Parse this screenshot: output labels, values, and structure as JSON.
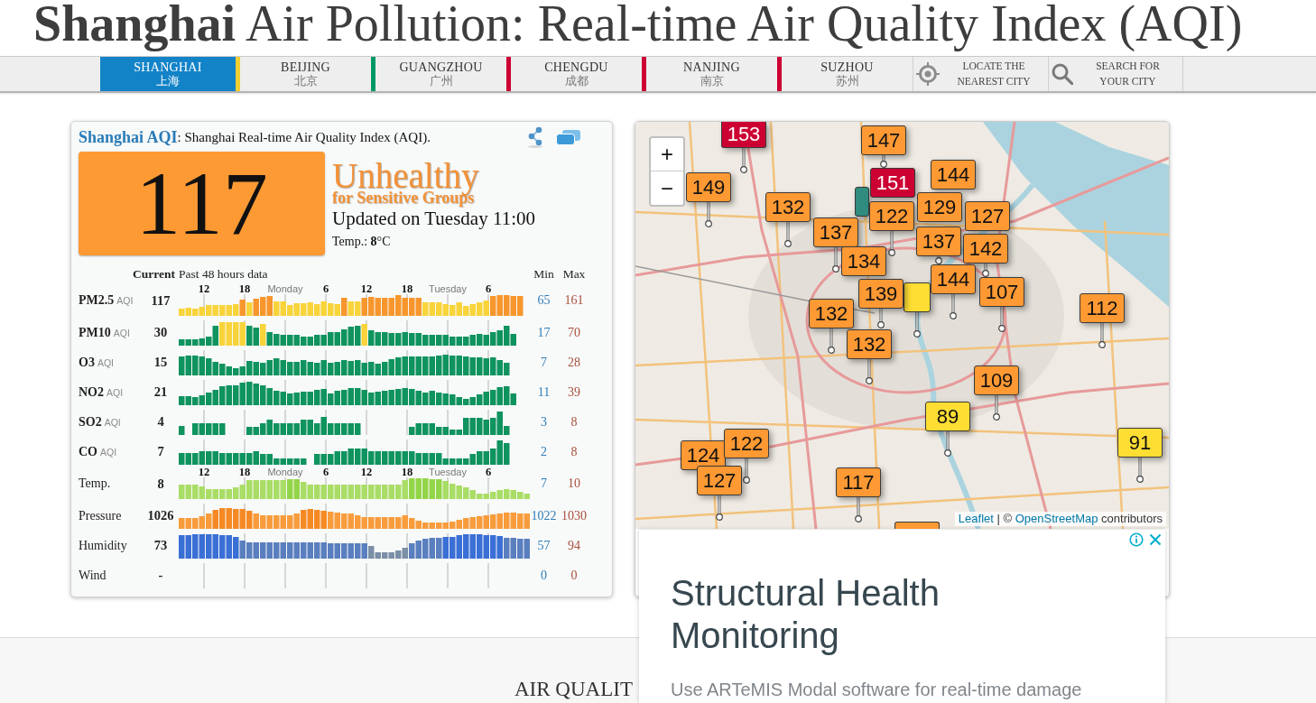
{
  "page_title": "**Shanghai** Air Pollution: Real-time Air Quality Index (AQI)",
  "nav": {
    "items": [
      {
        "kind": "city",
        "label": "SHANGHAI",
        "label_zh": "上海",
        "selected": true
      },
      {
        "kind": "city",
        "label": "BEIJING",
        "label_zh": "北京",
        "selected": false,
        "color": "#f4cf33"
      },
      {
        "kind": "city",
        "label": "GUANGZHOU",
        "label_zh": "广州",
        "selected": false,
        "color": "#009966"
      },
      {
        "kind": "city",
        "label": "CHENGDU",
        "label_zh": "成都",
        "selected": false,
        "color": "#cc0033"
      },
      {
        "kind": "city",
        "label": "NANJING",
        "label_zh": "南京",
        "selected": false,
        "color": "#cc0033"
      },
      {
        "kind": "city",
        "label": "SUZHOU",
        "label_zh": "苏州",
        "selected": false,
        "color": "#cc0033"
      },
      {
        "kind": "locate",
        "label": "LOCATE THE NEAREST CITY",
        "selected": false
      },
      {
        "kind": "search",
        "label": "SEARCH FOR YOUR CITY",
        "selected": false
      }
    ]
  },
  "aqi_card": {
    "title": "Shanghai AQI",
    "subtitle": ": Shanghai Real-time Air Quality Index (AQI).",
    "aqi": "117",
    "status": "Unhealthy",
    "status_detail": "for Sensitive Groups",
    "updated": "Updated on Tuesday 11:00",
    "temperature": "Temp.: **8**°C",
    "table": {
      "columns": [
        "Current",
        "Past 48 hours data",
        "Min",
        "Max"
      ],
      "rows": [
        {
          "kind": "pollutant",
          "name": "PM2.5",
          "unit": "AQI",
          "current": "117",
          "min": "65",
          "max": "161",
          "axis": [
            {
              "label": "12",
              "kind": "hour"
            },
            {
              "label": "18",
              "kind": "hour"
            },
            {
              "label": "Monday",
              "kind": "day"
            },
            {
              "label": "6",
              "kind": "hour"
            },
            {
              "label": "12",
              "kind": "hour"
            },
            {
              "label": "18",
              "kind": "hour"
            },
            {
              "label": "Tuesday",
              "kind": "day"
            },
            {
              "label": "6",
              "kind": "hour"
            }
          ]
        },
        {
          "kind": "pollutant",
          "name": "PM10",
          "unit": "AQI",
          "current": "30",
          "min": "17",
          "max": "70"
        },
        {
          "kind": "pollutant",
          "name": "O3",
          "unit": "AQI",
          "current": "15",
          "min": "7",
          "max": "28"
        },
        {
          "kind": "pollutant",
          "name": "NO2",
          "unit": "AQI",
          "current": "21",
          "min": "11",
          "max": "39"
        },
        {
          "kind": "pollutant",
          "name": "SO2",
          "unit": "AQI",
          "current": "4",
          "min": "3",
          "max": "8"
        },
        {
          "kind": "pollutant",
          "name": "CO",
          "unit": "AQI",
          "current": "7",
          "min": "2",
          "max": "8"
        },
        {
          "kind": "weather",
          "name": "Temp.",
          "current": "8",
          "min": "7",
          "max": "10",
          "axis": [
            {
              "label": "12",
              "kind": "hour"
            },
            {
              "label": "18",
              "kind": "hour"
            },
            {
              "label": "Monday",
              "kind": "day"
            },
            {
              "label": "6",
              "kind": "hour"
            },
            {
              "label": "12",
              "kind": "hour"
            },
            {
              "label": "18",
              "kind": "hour"
            },
            {
              "label": "Tuesday",
              "kind": "day"
            },
            {
              "label": "6",
              "kind": "hour"
            }
          ]
        },
        {
          "kind": "weather",
          "name": "Pressure",
          "current": "1026",
          "min": "1022",
          "max": "1030"
        },
        {
          "kind": "weather",
          "name": "Humidity",
          "current": "73",
          "min": "57",
          "max": "94"
        },
        {
          "kind": "weather",
          "name": "Wind",
          "current": "-",
          "min": "0",
          "max": "0"
        }
      ]
    }
  },
  "map": {
    "zoom_in": "+",
    "zoom_out": "−",
    "markers": [
      {
        "value": "153",
        "color": "#cc0033"
      },
      {
        "value": "147",
        "color": "#ff9933"
      },
      {
        "value": "149",
        "color": "#ff9933"
      },
      {
        "value": "151",
        "color": "#cc0033"
      },
      {
        "value": "144",
        "color": "#ff9933"
      },
      {
        "value": "132",
        "color": "#ff9933"
      },
      {
        "color": "#2f8c7e"
      },
      {
        "value": "122",
        "color": "#ff9933"
      },
      {
        "value": "129",
        "color": "#ff9933"
      },
      {
        "value": "127",
        "color": "#ff9933"
      },
      {
        "value": "137",
        "color": "#ff9933"
      },
      {
        "value": "137",
        "color": "#ff9933"
      },
      {
        "value": "134",
        "color": "#ff9933"
      },
      {
        "value": "142",
        "color": "#ff9933"
      },
      {
        "value": "139",
        "color": "#ff9933"
      },
      {
        "value": "144",
        "color": "#ff9933"
      },
      {
        "color": "#ffde33"
      },
      {
        "value": "107",
        "color": "#ff9933"
      },
      {
        "value": "132",
        "color": "#ff9933"
      },
      {
        "value": "112",
        "color": "#ff9933"
      },
      {
        "value": "132",
        "color": "#ff9933"
      },
      {
        "value": "109",
        "color": "#ff9933"
      },
      {
        "value": "89",
        "color": "#ffde33"
      },
      {
        "value": "124",
        "color": "#ff9933"
      },
      {
        "value": "122",
        "color": "#ff9933"
      },
      {
        "value": "91",
        "color": "#ffde33"
      },
      {
        "value": "127",
        "color": "#ff9933"
      },
      {
        "value": "117",
        "color": "#ff9933"
      },
      {
        "color": "#ff9933"
      }
    ],
    "attribution": [
      {
        "kind": "link",
        "text": "Leaflet"
      },
      {
        "kind": "text",
        "text": " | © "
      },
      {
        "kind": "link",
        "text": "OpenStreetMap"
      },
      {
        "kind": "text",
        "text": " contributors"
      }
    ]
  },
  "ad": {
    "title": "Structural Health Monitoring",
    "text": "Use ARTeMIS Modal software for real-time damage"
  },
  "section_heading": "AIR QUALIT"
}
